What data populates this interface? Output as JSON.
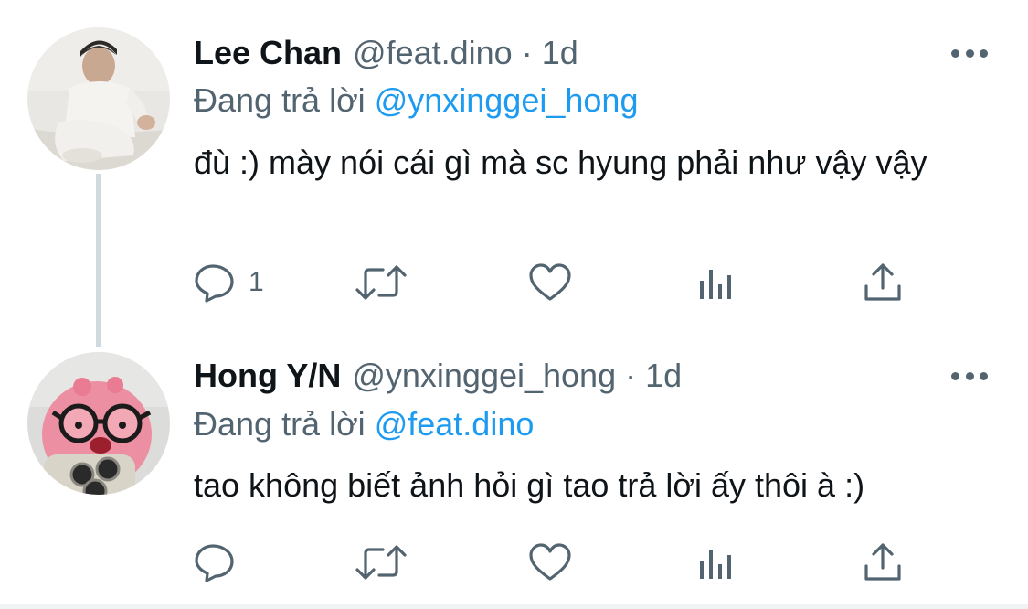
{
  "tweets": [
    {
      "name": "Lee Chan",
      "handle": "@feat.dino",
      "separator": "·",
      "time": "1d",
      "replying_prefix": "Đang trả lời",
      "replying_to": "@ynxinggei_hong",
      "text": "đù :) mày nói cái gì mà sc hyung phải như vậy vậy",
      "reply_count": "1",
      "avatar": "user-photo-avatar"
    },
    {
      "name": "Hong Y/N",
      "handle": "@ynxinggei_hong",
      "separator": "·",
      "time": "1d",
      "replying_prefix": "Đang trả lời",
      "replying_to": "@feat.dino",
      "text": "tao không biết ảnh hỏi gì tao trả lời ấy thôi à :)",
      "reply_count": "",
      "avatar": "pink-plush-avatar"
    }
  ],
  "icons": {
    "reply": "comment-icon",
    "retweet": "retweet-icon",
    "like": "heart-icon",
    "views": "analytics-icon",
    "share": "share-icon",
    "more": "more-dots-icon"
  },
  "colors": {
    "text": "#0f1419",
    "secondary": "#536471",
    "link": "#1d9bf0",
    "thread_line": "#cfd9de"
  }
}
